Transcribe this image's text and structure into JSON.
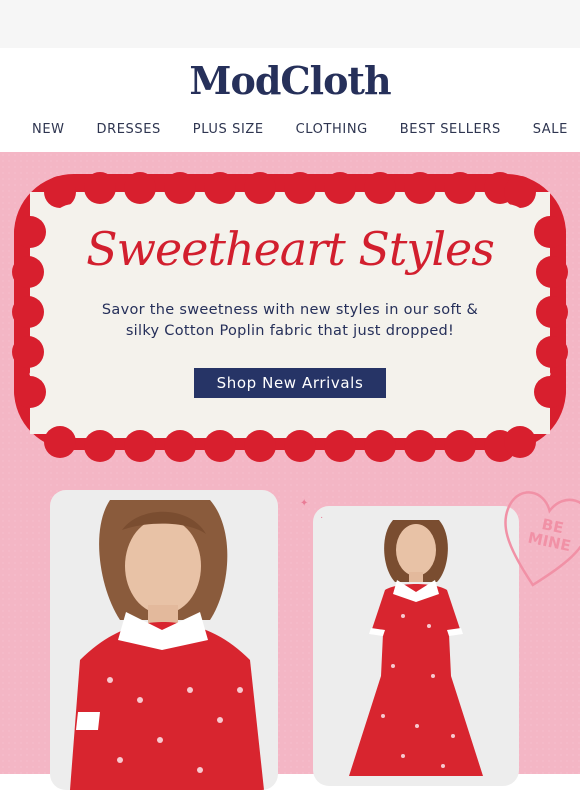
{
  "brand": {
    "logo_text": "ModCloth"
  },
  "nav": {
    "items": [
      "NEW",
      "DRESSES",
      "PLUS SIZE",
      "CLOTHING",
      "BEST SELLERS",
      "SALE"
    ]
  },
  "hero": {
    "headline": "Sweetheart Styles",
    "subtext": "Savor the sweetness with new styles in our soft & silky Cotton Poplin fabric that just dropped!",
    "cta_label": "Shop New Arrivals",
    "heart_text_line1": "BE",
    "heart_text_line2": "MINE"
  },
  "colors": {
    "brand_navy": "#26305a",
    "hero_pink": "#f4b6c5",
    "accent_red": "#d81f2e",
    "card_cream": "#f4f2ec"
  },
  "products": [
    {
      "name": "red-heart-print-dress-model-closeup"
    },
    {
      "name": "red-heart-print-dress-model-full"
    }
  ]
}
